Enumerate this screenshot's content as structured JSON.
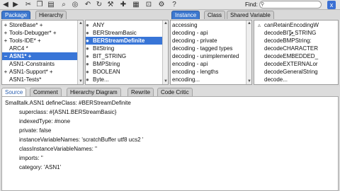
{
  "toolbar": {
    "icons": [
      "arrow-left-icon",
      "arrow-right-icon",
      "scissors-icon",
      "copy-icon",
      "paste-icon",
      "search-icon",
      "find-icon",
      "undo-icon",
      "refresh-icon",
      "tool-icon",
      "new-icon",
      "browse-icon",
      "lock-icon",
      "gear-icon",
      "help-icon"
    ],
    "find_label": "Find:",
    "find_value": "",
    "close_label": "x"
  },
  "top_tabs": {
    "package": "Package",
    "hierarchy": "Hierarchy",
    "instance": "Instance",
    "class": "Class",
    "shared_variable": "Shared Variable"
  },
  "packages": [
    {
      "label": "StoreBase* +",
      "prefix": "+",
      "selected": false
    },
    {
      "label": "Tools-Debugger* +",
      "prefix": "+",
      "selected": false
    },
    {
      "label": "Tools-IDE* +",
      "prefix": "+",
      "selected": false
    },
    {
      "label": "ARC4 *",
      "prefix": "",
      "selected": false
    },
    {
      "label": "ASN1* +",
      "prefix": "−",
      "selected": true
    },
    {
      "label": "ASN1-Constraints",
      "prefix": "",
      "selected": false
    },
    {
      "label": "ASN1-Support* +",
      "prefix": "+",
      "selected": false
    },
    {
      "label": "ASN1-Tests*",
      "prefix": "",
      "selected": false
    }
  ],
  "classes": [
    {
      "label": "ANY",
      "selected": false
    },
    {
      "label": "BERStreamBasic",
      "selected": false
    },
    {
      "label": "BERStreamDefinite",
      "selected": true
    },
    {
      "label": "BitString",
      "selected": false
    },
    {
      "label": "BIT_STRING",
      "selected": false
    },
    {
      "label": "BMPString",
      "selected": false
    },
    {
      "label": "BOOLEAN",
      "selected": false
    },
    {
      "label": "Byte...",
      "selected": false
    }
  ],
  "protocols": [
    "accessing",
    "decoding - api",
    "decoding - private",
    "decoding - tagged types",
    "decoding - unimplemented",
    "encoding - api",
    "encoding - lengths",
    "encoding..."
  ],
  "methods": [
    "canRetainEncodingW",
    "decodeBIT_STRING",
    "decodeBMPString:",
    "decodeCHARACTER",
    "decodeEMBEDDED_",
    "decodeEXTERNALor",
    "decodeGeneralString",
    "decode..."
  ],
  "source_tabs": {
    "source": "Source",
    "comment": "Comment",
    "hierarchy_diagram": "Hierarchy Diagram",
    "rewrite": "Rewrite",
    "code_critic": "Code Critic"
  },
  "code_lines": [
    "Smalltalk.ASN1 defineClass: #BERStreamDefinite",
    "superclass: #{ASN1.BERStreamBasic}",
    "indexedType: #none",
    "private: false",
    "instanceVariableNames: 'scratchBuffer utf8 ucs2 '",
    "classInstanceVariableNames: ''",
    "imports: ''",
    "category: 'ASN1'"
  ]
}
